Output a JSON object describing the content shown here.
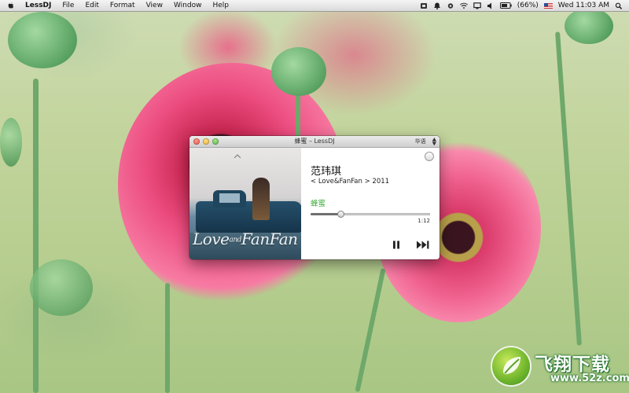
{
  "menubar": {
    "app_name": "LessDJ",
    "menus": [
      "File",
      "Edit",
      "Format",
      "View",
      "Window",
      "Help"
    ],
    "battery": "(66%)",
    "clock": "Wed 11:03 AM"
  },
  "player": {
    "window_title": "蜂蜜 – LessDJ",
    "channel": "华语",
    "artist": "范玮琪",
    "album_line": "< Love&FanFan > 2011",
    "song": "蜂蜜",
    "elapsed": "1:12",
    "progress_fraction": 0.25,
    "album_art_text": {
      "love": "Love",
      "and": "and",
      "fanfan": "FanFan"
    },
    "accent_color": "#39a935"
  },
  "watermark": {
    "title": "飞翔下载",
    "url": "www.52z.com"
  }
}
